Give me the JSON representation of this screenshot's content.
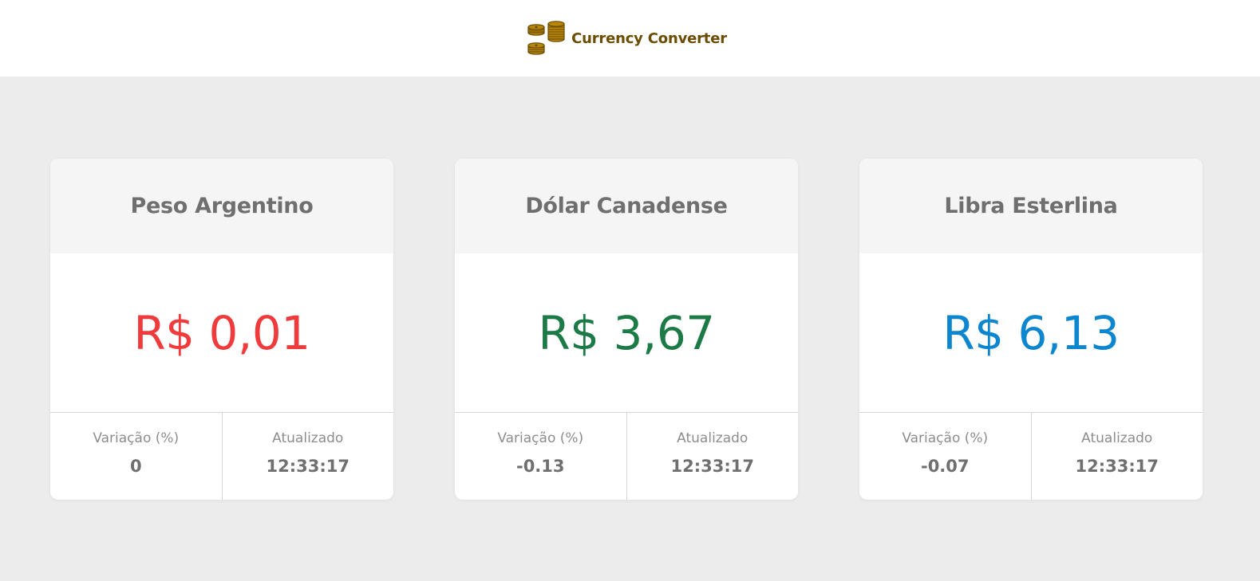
{
  "header": {
    "icon": "coins-icon",
    "title": "Currency Converter"
  },
  "colors": {
    "brand": "#6b4c00",
    "negative": "#ef3b3b",
    "positive": "#1b7a45",
    "neutral": "#0c86cf"
  },
  "cards": [
    {
      "name": "Peso Argentino",
      "price": "R$ 0,01",
      "color": "#ef3b3b",
      "variation_label": "Variação (%)",
      "variation_value": "0",
      "updated_label": "Atualizado",
      "updated_value": "12:33:17"
    },
    {
      "name": "Dólar Canadense",
      "price": "R$ 3,67",
      "color": "#1b7a45",
      "variation_label": "Variação (%)",
      "variation_value": "-0.13",
      "updated_label": "Atualizado",
      "updated_value": "12:33:17"
    },
    {
      "name": "Libra Esterlina",
      "price": "R$ 6,13",
      "color": "#0c86cf",
      "variation_label": "Variação (%)",
      "variation_value": "-0.07",
      "updated_label": "Atualizado",
      "updated_value": "12:33:17"
    }
  ]
}
